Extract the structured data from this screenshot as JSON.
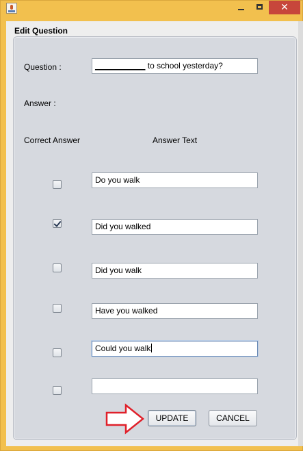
{
  "window": {
    "title_icon": "java-icon",
    "minimize_icon": "minimize-icon",
    "maximize_icon": "maximize-icon",
    "close_label": "✕"
  },
  "panel": {
    "title": "Edit Question"
  },
  "form": {
    "question_label": "Question :",
    "question_blank": "___________",
    "question_text": " to school yesterday?",
    "answer_label": "Answer   :",
    "correct_answer_header": "Correct Answer",
    "answer_text_header": "Answer Text",
    "answers": [
      {
        "checked": false,
        "text": "Do you walk"
      },
      {
        "checked": true,
        "text": "Did you walked"
      },
      {
        "checked": false,
        "text": "Did you walk"
      },
      {
        "checked": false,
        "text": "Have you walked"
      },
      {
        "checked": false,
        "text": "Could you walk"
      },
      {
        "checked": false,
        "text": ""
      }
    ]
  },
  "buttons": {
    "update_label": "UPDATE",
    "cancel_label": "CANCEL"
  },
  "annotation": {
    "arrow_color": "#e0202a"
  }
}
